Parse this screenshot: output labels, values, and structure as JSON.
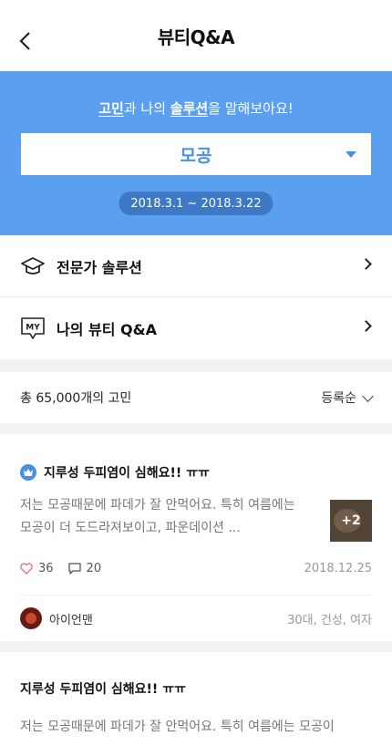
{
  "header": {
    "title": "뷰티Q&A"
  },
  "hero": {
    "caption_em1": "고민",
    "caption_mid": "과 나의 ",
    "caption_em2": "솔루션",
    "caption_end": "을 말해보아요!",
    "selected": "모공",
    "date_range": "2018.3.1 ~ 2018.3.22",
    "bg_color": "#5a9ff0"
  },
  "menu": [
    {
      "label": "전문가 솔루션",
      "icon": "graduation-cap-icon"
    },
    {
      "label": "나의 뷰티 Q&A",
      "icon": "my-chat-icon"
    }
  ],
  "list": {
    "count_text": "총 65,000개의 고민",
    "sort_label": "등록순"
  },
  "posts": [
    {
      "title": "지루성 두피염이 심해요!! ㅠㅠ",
      "text": "저는 모공때문에 파데가 잘 안먹어요. 특히 여름에는 모공이 더 도드라져보이고, 파운데이션 ...",
      "thumb_extra": "+2",
      "likes": "36",
      "comments": "20",
      "date": "2018.12.25",
      "author": "아이언맨",
      "author_info": "30대, 건성, 여자"
    },
    {
      "title": "지루성 두피염이 심해요!! ㅠㅠ",
      "text": "저는 모공때문에 파데가 잘 안먹어요.  특히 여름에는 모공이"
    }
  ]
}
